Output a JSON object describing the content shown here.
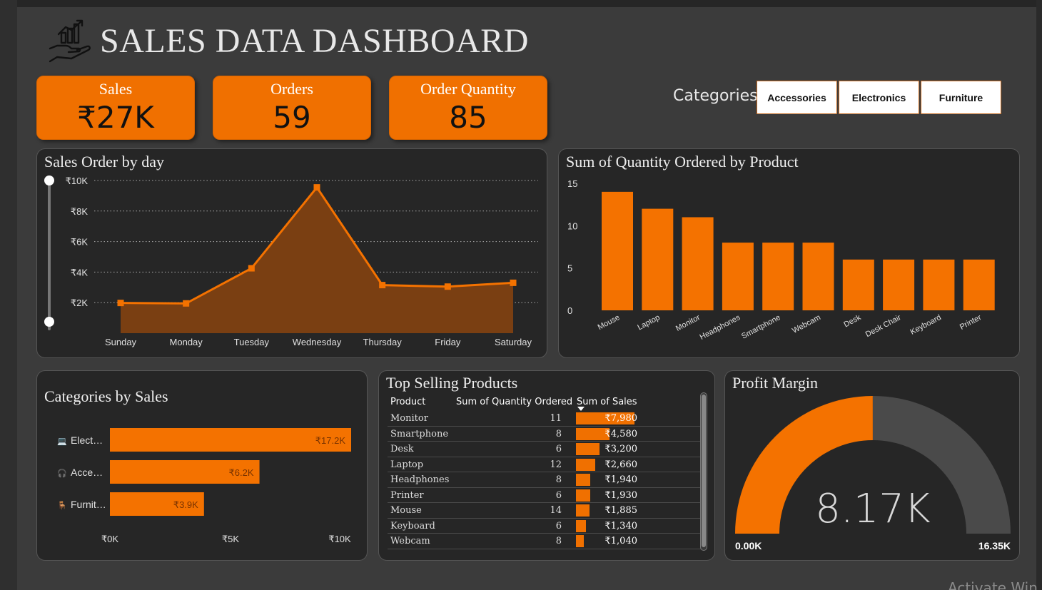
{
  "header": {
    "title": "SALES DATA DASHBOARD",
    "icon": "growth-hand-chart-icon"
  },
  "kpis": [
    {
      "label": "Sales",
      "value": "₹27K"
    },
    {
      "label": "Orders",
      "value": "59"
    },
    {
      "label": "Order Quantity",
      "value": "85"
    }
  ],
  "categories_filter": {
    "label": "Categories",
    "options": [
      "Accessories",
      "Electronics",
      "Furniture"
    ]
  },
  "colors": {
    "accent": "#f47200",
    "panel": "#262626",
    "background": "#3b3b3b",
    "area_fill": "#7a3f12"
  },
  "sales_by_day": {
    "title": "Sales Order by day",
    "chart_data": {
      "type": "area",
      "categories": [
        "Sunday",
        "Monday",
        "Tuesday",
        "Wednesday",
        "Thursday",
        "Friday",
        "Saturday"
      ],
      "values": [
        1980,
        1950,
        4250,
        9550,
        3150,
        3050,
        3300
      ],
      "y_ticks": [
        "₹2K",
        "₹4K",
        "₹6K",
        "₹8K",
        "₹10K"
      ],
      "y_tick_values": [
        2000,
        4000,
        6000,
        8000,
        10000
      ],
      "ylim": [
        0,
        10000
      ],
      "grid": true
    }
  },
  "qty_by_product": {
    "title": "Sum of Quantity Ordered by Product",
    "chart_data": {
      "type": "bar",
      "categories": [
        "Mouse",
        "Laptop",
        "Monitor",
        "Headphones",
        "Smartphone",
        "Webcam",
        "Desk",
        "Desk Chair",
        "Keyboard",
        "Printer"
      ],
      "values": [
        14,
        12,
        11,
        8,
        8,
        8,
        6,
        6,
        6,
        6
      ],
      "y_ticks": [
        "0",
        "5",
        "10",
        "15"
      ],
      "y_tick_values": [
        0,
        5,
        10,
        15
      ],
      "ylim": [
        0,
        15
      ]
    }
  },
  "categories_by_sales": {
    "title": "Categories by Sales",
    "chart_data": {
      "type": "bar",
      "orientation": "horizontal",
      "categories": [
        "Elect…",
        "Acce…",
        "Furnit…"
      ],
      "icons": [
        "laptop-icon",
        "headphones-icon",
        "chair-icon"
      ],
      "values": [
        17200,
        6200,
        3900
      ],
      "data_labels": [
        "₹17.2K",
        "₹6.2K",
        "₹3.9K"
      ],
      "x_ticks": [
        "₹0K",
        "₹5K",
        "₹10K"
      ],
      "x_tick_values": [
        0,
        5000,
        10000
      ],
      "xlim": [
        0,
        10000
      ]
    }
  },
  "top_selling": {
    "title": "Top Selling Products",
    "columns": [
      "Product",
      "Sum of Quantity Ordered",
      "Sum of Sales"
    ],
    "rows": [
      {
        "product": "Monitor",
        "qty": "11",
        "sales": "₹7,980",
        "sales_value": 7980
      },
      {
        "product": "Smartphone",
        "qty": "8",
        "sales": "₹4,580",
        "sales_value": 4580
      },
      {
        "product": "Desk",
        "qty": "6",
        "sales": "₹3,200",
        "sales_value": 3200
      },
      {
        "product": "Laptop",
        "qty": "12",
        "sales": "₹2,660",
        "sales_value": 2660
      },
      {
        "product": "Headphones",
        "qty": "8",
        "sales": "₹1,940",
        "sales_value": 1940
      },
      {
        "product": "Printer",
        "qty": "6",
        "sales": "₹1,930",
        "sales_value": 1930
      },
      {
        "product": "Mouse",
        "qty": "14",
        "sales": "₹1,885",
        "sales_value": 1885
      },
      {
        "product": "Keyboard",
        "qty": "6",
        "sales": "₹1,340",
        "sales_value": 1340
      },
      {
        "product": "Webcam",
        "qty": "8",
        "sales": "₹1,040",
        "sales_value": 1040
      }
    ],
    "max_sales": 7980
  },
  "profit_margin": {
    "title": "Profit Margin",
    "chart_data": {
      "type": "gauge",
      "value": 8170,
      "value_label": "8.17K",
      "min": 0,
      "max": 16350,
      "min_label": "0.00K",
      "max_label": "16.35K"
    }
  },
  "watermark": "Activate Win"
}
